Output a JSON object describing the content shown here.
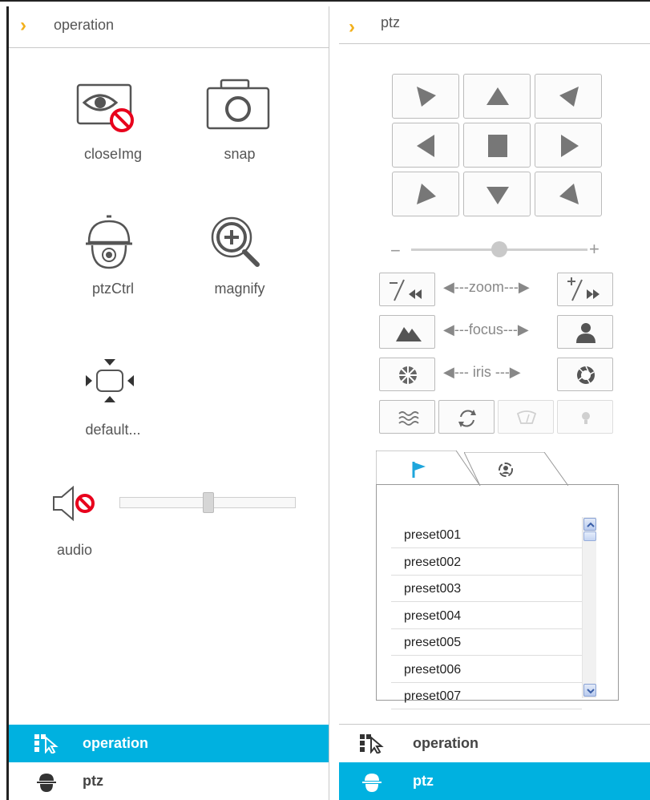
{
  "left": {
    "header": {
      "title": "operation"
    },
    "tools": [
      {
        "label": "closeImg"
      },
      {
        "label": "snap"
      },
      {
        "label": "ptzCtrl"
      },
      {
        "label": "magnify"
      },
      {
        "label": "default..."
      }
    ],
    "audio": {
      "label": "audio",
      "volume_fraction": 0.5
    },
    "nav": [
      {
        "label": "operation",
        "active": true
      },
      {
        "label": "ptz",
        "active": false
      }
    ]
  },
  "right": {
    "header": {
      "title": "ptz"
    },
    "speed": {
      "minus": "−",
      "plus": "+",
      "value_fraction": 0.5
    },
    "zoom": {
      "label": "zoom",
      "minus_text": "−",
      "plus_text": "+"
    },
    "focus": {
      "label": "focus"
    },
    "iris": {
      "label": "iris"
    },
    "presets": [
      "preset001",
      "preset002",
      "preset003",
      "preset004",
      "preset005",
      "preset006",
      "preset007"
    ],
    "nav": [
      {
        "label": "operation",
        "active": false
      },
      {
        "label": "ptz",
        "active": true
      }
    ]
  },
  "colors": {
    "accent": "#00b1e0",
    "chevron": "#f2b01c",
    "icon": "#555555",
    "disabled_icon": "#d0d0d0",
    "cancel": "#e8001c"
  }
}
